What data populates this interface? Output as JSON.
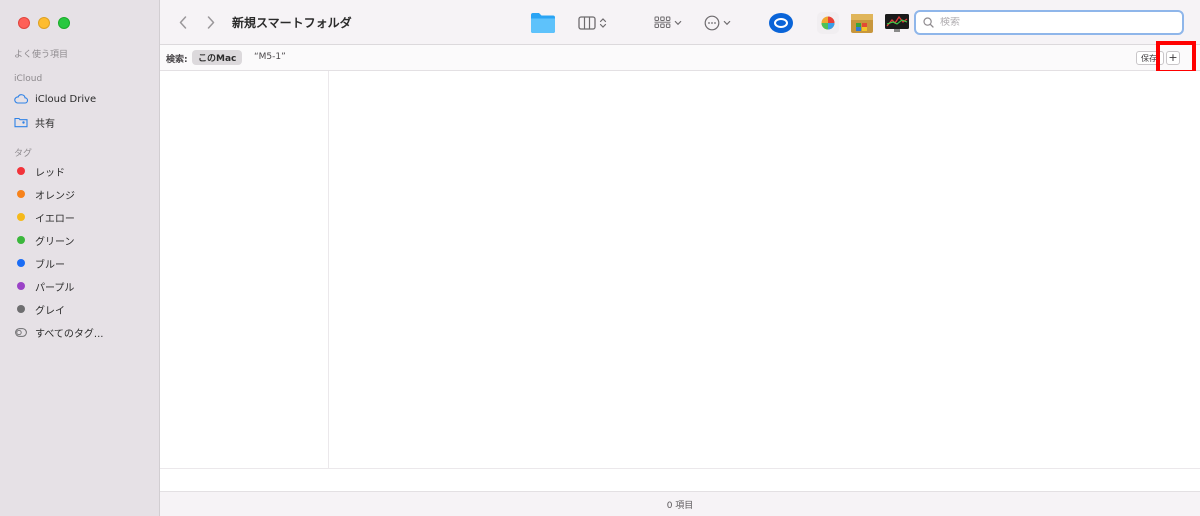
{
  "window": {
    "title": "新規スマートフォルダ"
  },
  "sidebar": {
    "favorites_header": "よく使う項目",
    "icloud_header": "iCloud",
    "icloud_items": [
      {
        "label": "iCloud Drive",
        "icon": "cloud-icon"
      },
      {
        "label": "共有",
        "icon": "shared-folder-icon"
      }
    ],
    "tags_header": "タグ",
    "tags": [
      {
        "label": "レッド",
        "color": "#f2333a"
      },
      {
        "label": "オレンジ",
        "color": "#f7821b"
      },
      {
        "label": "イエロー",
        "color": "#f5b91a"
      },
      {
        "label": "グリーン",
        "color": "#3bb73c"
      },
      {
        "label": "ブルー",
        "color": "#1a6cf5"
      },
      {
        "label": "パープル",
        "color": "#9b43c7"
      },
      {
        "label": "グレイ",
        "color": "#6e6e70"
      }
    ],
    "all_tags": "すべてのタグ..."
  },
  "toolbar": {
    "back_icon": "chevron-left-icon",
    "forward_icon": "chevron-right-icon",
    "folder_icon": "folder-icon",
    "view_icon": "column-view-icon",
    "group_icon": "group-icon",
    "action_icon": "more-icon"
  },
  "search": {
    "placeholder": "検索",
    "value": ""
  },
  "scope": {
    "label": "検索:",
    "this_mac": "このMac",
    "term": "“M5-1”",
    "save": "保存",
    "add": "+"
  },
  "status": {
    "count": "0 項目"
  }
}
